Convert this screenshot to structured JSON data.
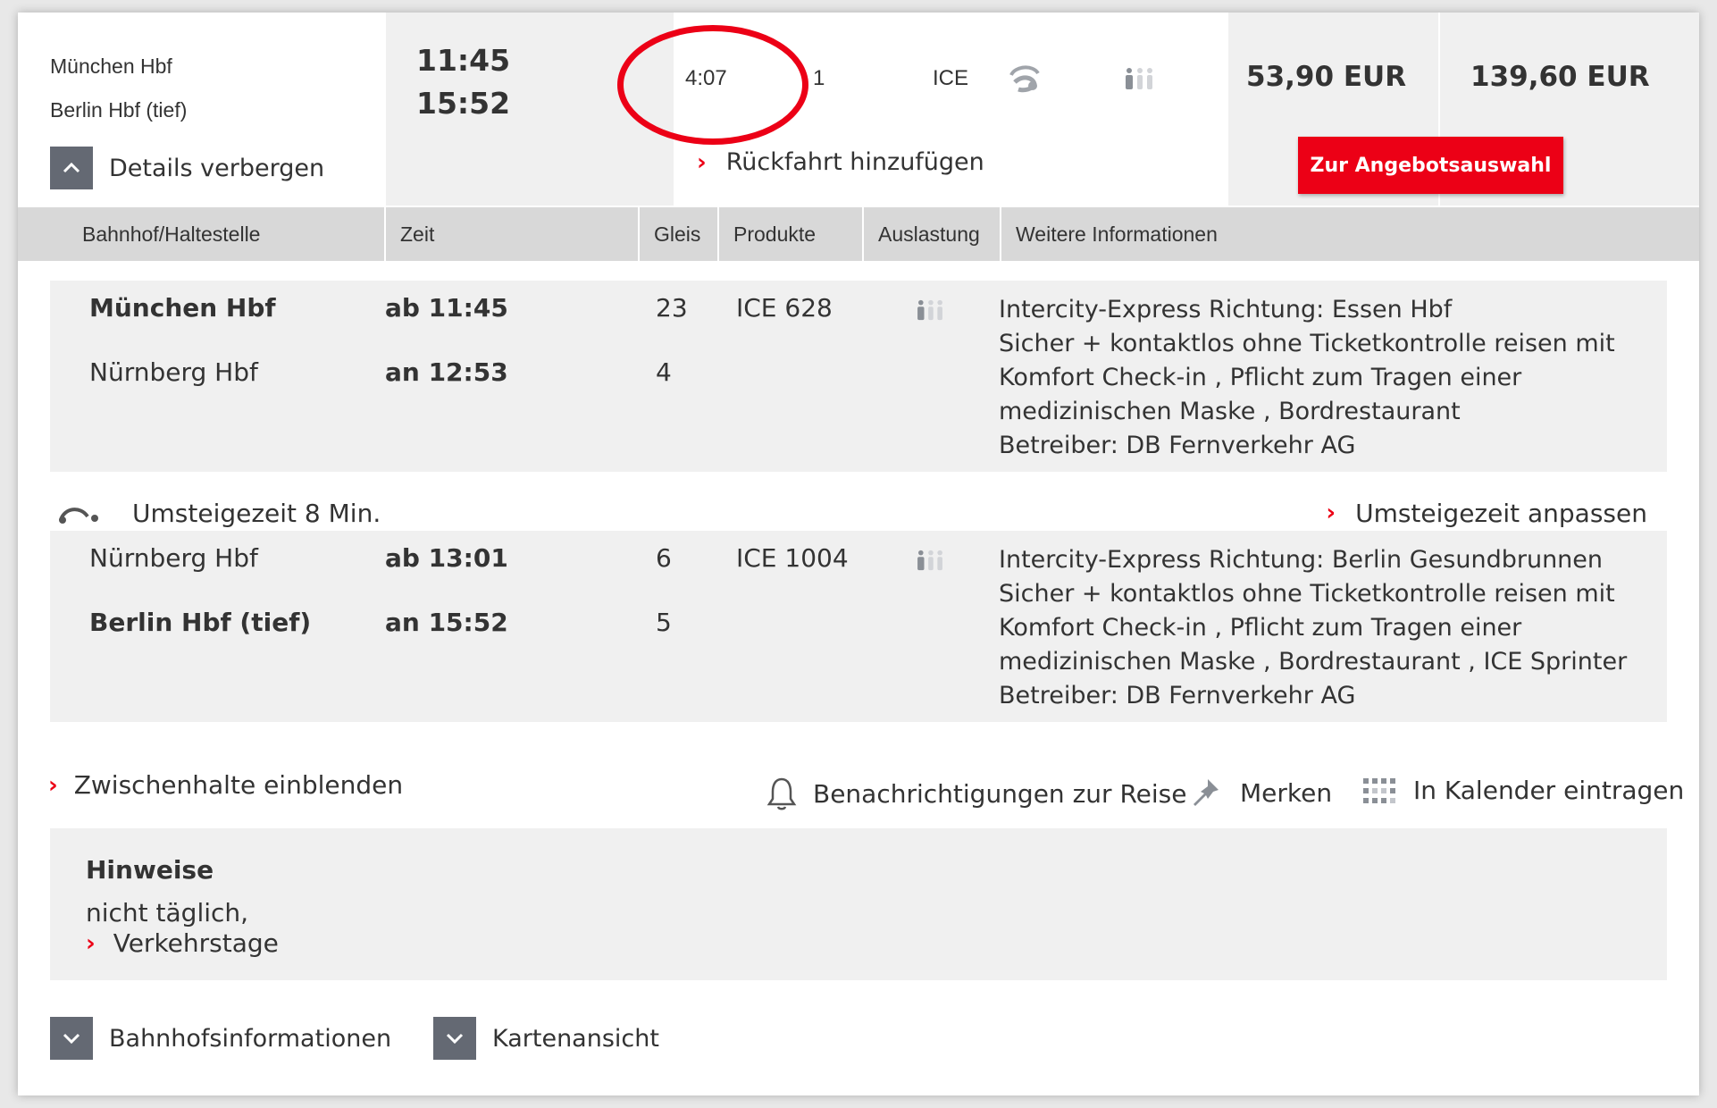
{
  "summary": {
    "from": "München Hbf",
    "to": "Berlin Hbf (tief)",
    "departure": "11:45",
    "arrival": "15:52",
    "duration": "4:07",
    "changes": "1",
    "products": "ICE",
    "price_1": "53,90 EUR",
    "price_2": "139,60 EUR",
    "offer_button": "Zur Angebotsauswahl",
    "details_toggle": "Details verbergen",
    "return_link": "Rückfahrt hinzufügen"
  },
  "table_headers": [
    "Bahnhof/Haltestelle",
    "Zeit",
    "Gleis",
    "Produkte",
    "Auslastung",
    "Weitere Informationen"
  ],
  "legs": [
    {
      "from_station": "München Hbf",
      "from_time": "ab 11:45",
      "from_platform": "23",
      "to_station": "Nürnberg Hbf",
      "to_time": "an 12:53",
      "to_platform": "4",
      "product": "ICE 628",
      "info": [
        "Intercity-Express Richtung: Essen Hbf",
        "Sicher + kontaktlos ohne Ticketkontrolle reisen mit",
        "Komfort Check-in , Pflicht zum Tragen einer",
        "medizinischen Maske , Bordrestaurant",
        "Betreiber: DB Fernverkehr AG"
      ]
    },
    {
      "from_station": "Nürnberg Hbf",
      "from_time": "ab 13:01",
      "from_platform": "6",
      "to_station": "Berlin Hbf (tief)",
      "to_time": "an 15:52",
      "to_platform": "5",
      "product": "ICE 1004",
      "info": [
        "Intercity-Express Richtung: Berlin Gesundbrunnen",
        "Sicher + kontaktlos ohne Ticketkontrolle reisen mit",
        "Komfort Check-in , Pflicht zum Tragen einer",
        "medizinischen Maske , Bordrestaurant , ICE Sprinter",
        "Betreiber: DB Fernverkehr AG"
      ]
    }
  ],
  "transfer": {
    "label": "Umsteigezeit 8 Min.",
    "link": "Umsteigezeit anpassen"
  },
  "actions": {
    "stops": "Zwischenhalte einblenden",
    "notify": "Benachrichtigungen zur Reise",
    "bookmark": "Merken",
    "calendar": "In Kalender eintragen"
  },
  "hints": {
    "title": "Hinweise",
    "text": "nicht täglich,",
    "link": "Verkehrstage"
  },
  "footer": {
    "station_info": "Bahnhofsinformationen",
    "map_view": "Kartenansicht"
  },
  "colors": {
    "accent": "#ec0016",
    "panel": "#f0f0f0",
    "header": "#d8d8d8",
    "toggle": "#646973"
  }
}
